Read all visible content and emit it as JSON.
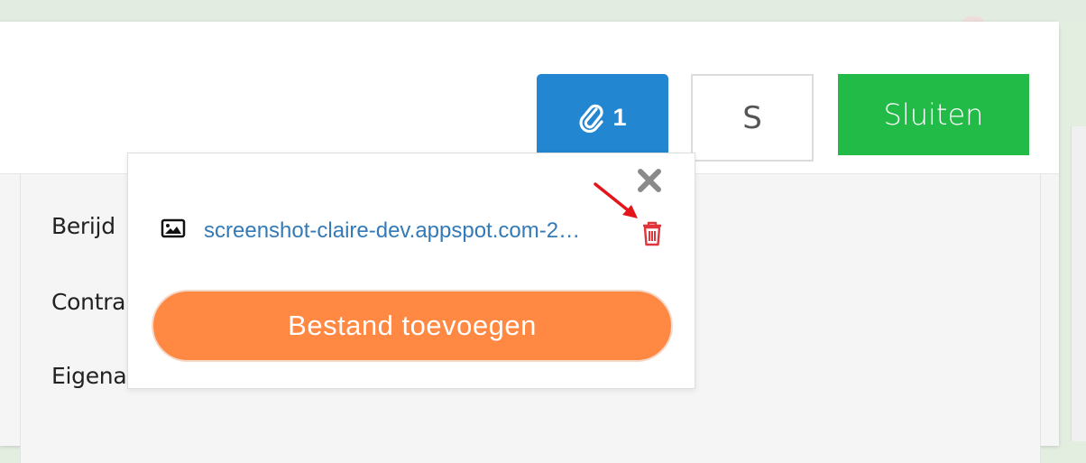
{
  "header": {
    "attachments_count": "1",
    "s_label": "S",
    "close_label": "Sluiten"
  },
  "form": {
    "labels": [
      "Berijd",
      "Contra",
      "Eigena"
    ]
  },
  "attachments_popover": {
    "files": [
      {
        "name": "screenshot-claire-dev.appspot.com-2…"
      }
    ],
    "add_button_label": "Bestand toevoegen"
  },
  "colors": {
    "attach_button": "#2287d0",
    "close_button": "#22bb48",
    "add_button": "#ff8843",
    "delete_icon": "#e0353b",
    "link": "#337ab7"
  },
  "icons": {
    "attach": "paperclip-icon",
    "popover_close": "close-icon",
    "file": "image-icon",
    "delete": "trash-icon",
    "annotation": "red-arrow"
  }
}
